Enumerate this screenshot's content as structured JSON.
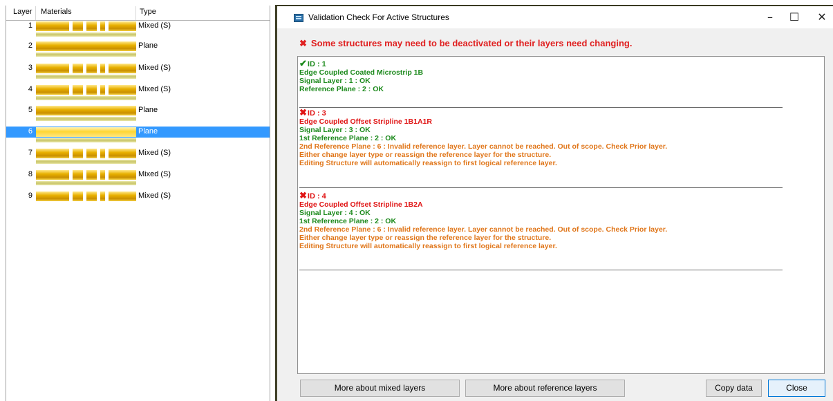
{
  "stackup": {
    "headers": {
      "layer": "Layer",
      "materials": "Materials",
      "type": "Type"
    },
    "rows": [
      {
        "num": "1",
        "type": "Mixed (S)",
        "pattern": "mixed",
        "selected": false
      },
      {
        "num": "2",
        "type": "Plane",
        "pattern": "plane",
        "selected": false
      },
      {
        "num": "3",
        "type": "Mixed (S)",
        "pattern": "mixed",
        "selected": false
      },
      {
        "num": "4",
        "type": "Mixed (S)",
        "pattern": "mixed",
        "selected": false
      },
      {
        "num": "5",
        "type": "Plane",
        "pattern": "plane",
        "selected": false
      },
      {
        "num": "6",
        "type": "Plane",
        "pattern": "plane",
        "selected": true
      },
      {
        "num": "7",
        "type": "Mixed (S)",
        "pattern": "mixed",
        "selected": false
      },
      {
        "num": "8",
        "type": "Mixed (S)",
        "pattern": "mixed",
        "selected": false
      },
      {
        "num": "9",
        "type": "Mixed (S)",
        "pattern": "mixed",
        "selected": false
      }
    ],
    "selection_color": "#3399ff"
  },
  "dialog": {
    "title": "Validation Check For Active Structures",
    "window_controls": {
      "minimize": "–",
      "maximize": "☐",
      "close": "✕"
    },
    "warning_mark": "✖",
    "warning": "Some structures may need to be deactivated or their layers need changing.",
    "entries": [
      {
        "status": "ok",
        "mark": "✔",
        "id_line": "ID : 1",
        "lines": [
          {
            "text": "Edge Coupled Coated Microstrip 1B",
            "color": "g"
          },
          {
            "text": "Signal Layer : 1 : OK",
            "color": "g"
          },
          {
            "text": "Reference Plane : 2 : OK",
            "color": "g"
          }
        ]
      },
      {
        "status": "error",
        "mark": "✖",
        "id_line": "ID : 3",
        "lines": [
          {
            "text": "Edge Coupled Offset Stripline 1B1A1R",
            "color": "r"
          },
          {
            "text": "Signal Layer : 3 : OK",
            "color": "g"
          },
          {
            "text": "1st Reference Plane : 2 : OK",
            "color": "g"
          },
          {
            "text": "2nd Reference Plane : 6 : Invalid reference layer. Layer cannot be reached. Out of scope. Check Prior layer.",
            "color": "o"
          },
          {
            "text": "Either change layer type or reassign the reference layer for the structure.",
            "color": "o"
          },
          {
            "text": "Editing Structure will automatically reassign to first logical reference layer.",
            "color": "o"
          }
        ]
      },
      {
        "status": "error",
        "mark": "✖",
        "id_line": "ID : 4",
        "lines": [
          {
            "text": "Edge Coupled Offset Stripline 1B2A",
            "color": "r"
          },
          {
            "text": "Signal Layer : 4 : OK",
            "color": "g"
          },
          {
            "text": "1st Reference Plane : 2 : OK",
            "color": "g"
          },
          {
            "text": "2nd Reference Plane : 6 : Invalid reference layer. Layer cannot be reached. Out of scope. Check Prior layer.",
            "color": "o"
          },
          {
            "text": "Either change layer type or reassign the reference layer for the structure.",
            "color": "o"
          },
          {
            "text": "Editing Structure will automatically reassign to first logical reference layer.",
            "color": "o"
          }
        ]
      }
    ],
    "buttons": {
      "mixed": "More about mixed layers",
      "reference": "More about reference layers",
      "copy": "Copy data",
      "close": "Close"
    },
    "colors": {
      "ok": "#1d8a1d",
      "error": "#e01515",
      "warning": "#e0761a"
    }
  }
}
